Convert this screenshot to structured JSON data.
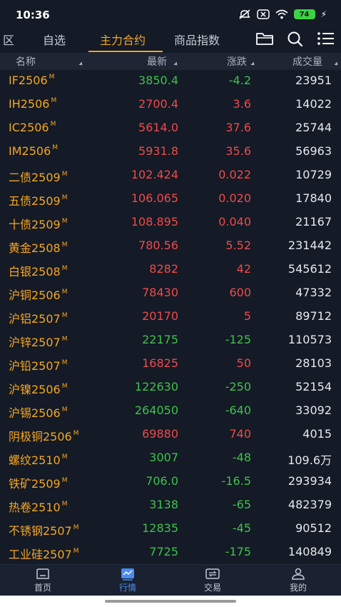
{
  "status": {
    "time": "10:36",
    "battery": "74"
  },
  "tabs": [
    {
      "label": "区"
    },
    {
      "label": "自选"
    },
    {
      "label": "主力合约"
    },
    {
      "label": "商品指数"
    }
  ],
  "columns": {
    "name": "名称",
    "price": "最新",
    "change": "涨跌",
    "volume": "成交量"
  },
  "rows": [
    {
      "name": "IF2506",
      "badge": "M",
      "price": "3850.4",
      "change": "-4.2",
      "volume": "23951",
      "dir": "down"
    },
    {
      "name": "IH2506",
      "badge": "M",
      "price": "2700.4",
      "change": "3.6",
      "volume": "14022",
      "dir": "up"
    },
    {
      "name": "IC2506",
      "badge": "M",
      "price": "5614.0",
      "change": "37.6",
      "volume": "25744",
      "dir": "up"
    },
    {
      "name": "IM2506",
      "badge": "M",
      "price": "5931.8",
      "change": "35.6",
      "volume": "56963",
      "dir": "up"
    },
    {
      "name": "二债2509",
      "badge": "M",
      "price": "102.424",
      "change": "0.022",
      "volume": "10729",
      "dir": "up"
    },
    {
      "name": "五债2509",
      "badge": "M",
      "price": "106.065",
      "change": "0.020",
      "volume": "17840",
      "dir": "up"
    },
    {
      "name": "十债2509",
      "badge": "M",
      "price": "108.895",
      "change": "0.040",
      "volume": "21167",
      "dir": "up"
    },
    {
      "name": "黄金2508",
      "badge": "M",
      "price": "780.56",
      "change": "5.52",
      "volume": "231442",
      "dir": "up"
    },
    {
      "name": "白银2508",
      "badge": "M",
      "price": "8282",
      "change": "42",
      "volume": "545612",
      "dir": "up"
    },
    {
      "name": "沪铜2506",
      "badge": "M",
      "price": "78430",
      "change": "600",
      "volume": "47332",
      "dir": "up"
    },
    {
      "name": "沪铝2507",
      "badge": "M",
      "price": "20170",
      "change": "5",
      "volume": "89712",
      "dir": "up"
    },
    {
      "name": "沪锌2507",
      "badge": "M",
      "price": "22175",
      "change": "-125",
      "volume": "110573",
      "dir": "down"
    },
    {
      "name": "沪铅2507",
      "badge": "M",
      "price": "16825",
      "change": "50",
      "volume": "28103",
      "dir": "up"
    },
    {
      "name": "沪镍2506",
      "badge": "M",
      "price": "122630",
      "change": "-250",
      "volume": "52154",
      "dir": "down"
    },
    {
      "name": "沪锡2506",
      "badge": "M",
      "price": "264050",
      "change": "-640",
      "volume": "33092",
      "dir": "down"
    },
    {
      "name": "阴极铜2506",
      "badge": "M",
      "price": "69880",
      "change": "740",
      "volume": "4015",
      "dir": "up"
    },
    {
      "name": "螺纹2510",
      "badge": "M",
      "price": "3007",
      "change": "-48",
      "volume": "109.6万",
      "dir": "down"
    },
    {
      "name": "铁矿2509",
      "badge": "M",
      "price": "706.0",
      "change": "-16.5",
      "volume": "293934",
      "dir": "down"
    },
    {
      "name": "热卷2510",
      "badge": "M",
      "price": "3138",
      "change": "-65",
      "volume": "482379",
      "dir": "down"
    },
    {
      "name": "不锈钢2507",
      "badge": "M",
      "price": "12835",
      "change": "-45",
      "volume": "90512",
      "dir": "down"
    },
    {
      "name": "工业硅2507",
      "badge": "M",
      "price": "7725",
      "change": "-175",
      "volume": "140849",
      "dir": "down"
    }
  ],
  "nav": [
    {
      "label": "首页",
      "icon": "home-icon"
    },
    {
      "label": "行情",
      "icon": "market-icon"
    },
    {
      "label": "交易",
      "icon": "trade-icon"
    },
    {
      "label": "我的",
      "icon": "profile-icon"
    }
  ],
  "colors": {
    "accent": "#f5a623",
    "up": "#ef4a4a",
    "down": "#3fc24b",
    "nav_active": "#4a8cf0",
    "background": "#141a26"
  }
}
